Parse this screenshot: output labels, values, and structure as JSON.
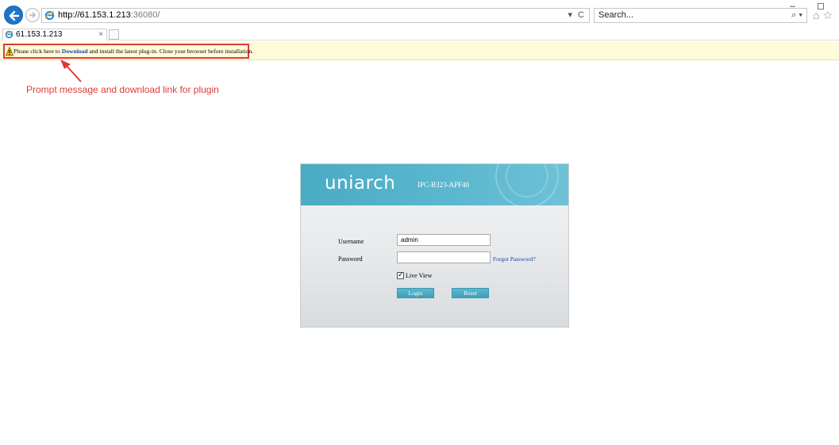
{
  "browser": {
    "url_main": "http://61.153.1.213",
    "url_port": ":36080/",
    "url_controls": "▾ C",
    "search_placeholder": "Search...",
    "search_controls": "⌕ ▾",
    "window_controls": "– ◻",
    "tab_title": "61.153.1.213",
    "tab_close": "×"
  },
  "info_bar": {
    "text_before": "Please click here to ",
    "link_text": "Download",
    "text_after": " and install the latest plug-in. Close your browser before installation."
  },
  "annotation": {
    "text": "Prompt message and download link for plugin",
    "color": "#e03a3a"
  },
  "login": {
    "brand": "uniarch",
    "model": "IPC-B323-APF40",
    "username_label": "Username",
    "username_value": "admin",
    "password_label": "Password",
    "password_value": "",
    "forgot_link": "Forgot Password?",
    "live_view_label": "Live View",
    "live_view_checked": true,
    "login_button": "Login",
    "reset_button": "Reset",
    "accent_color": "#4aabc4"
  }
}
